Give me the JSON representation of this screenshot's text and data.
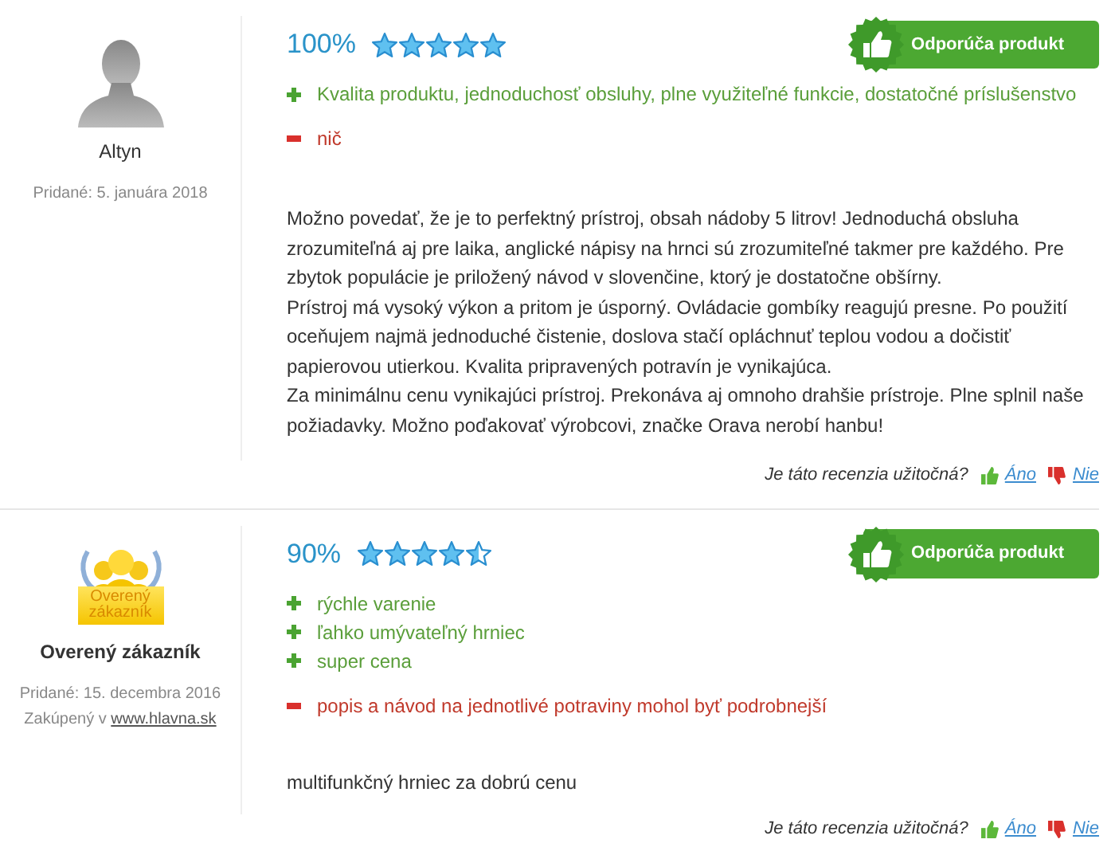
{
  "reviews": [
    {
      "author": {
        "kind": "anonymous",
        "name": "Altyn",
        "added": "Pridané: 5. januára 2018"
      },
      "score": "100%",
      "stars": 5,
      "recommends": true,
      "recommend_label": "Odporúča produkt",
      "pros": [
        "Kvalita produktu, jednoduchosť obsluhy, plne využiteľné funkcie, dostatočné príslušenstvo"
      ],
      "cons": [
        "nič"
      ],
      "text": [
        "Možno povedať, že je to perfektný prístroj, obsah nádoby 5 litrov! Jednoduchá obsluha zrozumiteľná aj pre laika, anglické nápisy na hrnci sú zrozumiteľné takmer pre každého. Pre zbytok populácie je priložený návod v slovenčine, ktorý je dostatočne obšírny.",
        "Prístroj má vysoký výkon a pritom je úsporný. Ovládacie gombíky reagujú presne. Po použití oceňujem najmä jednoduché čistenie, doslova stačí opláchnuť teplou vodou a dočistiť papierovou utierkou. Kvalita pripravených potravín je vynikajúca.",
        "Za minimálnu cenu vynikajúci prístroj. Prekonáva aj omnoho drahšie prístroje. Plne splnil naše požiadavky. Možno poďakovať výrobcovi, značke Orava nerobí hanbu!"
      ],
      "helpful": {
        "question": "Je táto recenzia užitočná?",
        "yes": "Áno",
        "no": "Nie"
      }
    },
    {
      "author": {
        "kind": "verified",
        "badge": "Overený zákazník",
        "name": "Overený zákazník",
        "added": "Pridané: 15. decembra 2016",
        "purchased": "Zakúpený v",
        "shop": "www.hlavna.sk"
      },
      "score": "90%",
      "stars": 4.5,
      "recommends": true,
      "recommend_label": "Odporúča produkt",
      "pros": [
        "rýchle varenie",
        "ľahko umývateľný hrniec",
        "super cena"
      ],
      "cons": [
        "popis a návod na jednotlivé potraviny mohol byť podrobnejší"
      ],
      "text": [
        "multifunkčný hrniec za dobrú cenu"
      ],
      "helpful": {
        "question": "Je táto recenzia užitočná?",
        "yes": "Áno",
        "no": "Nie"
      }
    }
  ]
}
